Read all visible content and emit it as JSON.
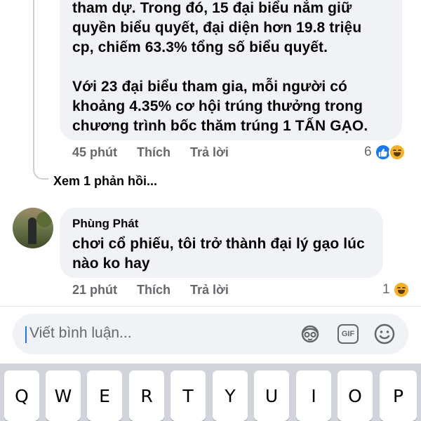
{
  "comment_1": {
    "text": "tham dự. Trong đó, 15 đại biểu nắm giữ\nquyền biểu quyết, đại diện hơn 19.8 triệu\ncp, chiếm 63.3% tổng số biểu quyết.\n\nVới 23 đại biểu tham gia, mỗi người có\nkhoảng 4.35% cơ hội trúng thưởng trong\nchương trình bốc thăm trúng 1 TẤN GẠO.",
    "time": "45 phút",
    "like_label": "Thích",
    "reply_label": "Trả lời",
    "reaction_count": "6",
    "reactions": [
      "like-icon",
      "haha-icon"
    ]
  },
  "view_replies": "Xem 1 phản hồi...",
  "comment_2": {
    "author": "Phùng Phát",
    "text": "chơi cổ phiếu, tôi trở thành đại lý gạo lúc\nnào ko hay",
    "time": "21 phút",
    "like_label": "Thích",
    "reply_label": "Trả lời",
    "reaction_count": "1",
    "reactions": [
      "haha-icon"
    ]
  },
  "comment_input": {
    "placeholder": "Viết bình luận...",
    "icons": [
      "avatar-sticker-icon",
      "gif-icon",
      "emoji-icon"
    ],
    "gif_label": "GIF"
  },
  "keyboard": {
    "row1": [
      "Q",
      "W",
      "E",
      "R",
      "T",
      "Y",
      "U",
      "I",
      "O",
      "P"
    ]
  },
  "colors": {
    "bubble": "#f0f2f5",
    "secondary_text": "#65676b",
    "like_blue": "#1877f2",
    "keyboard_bg": "#d1d4db"
  }
}
